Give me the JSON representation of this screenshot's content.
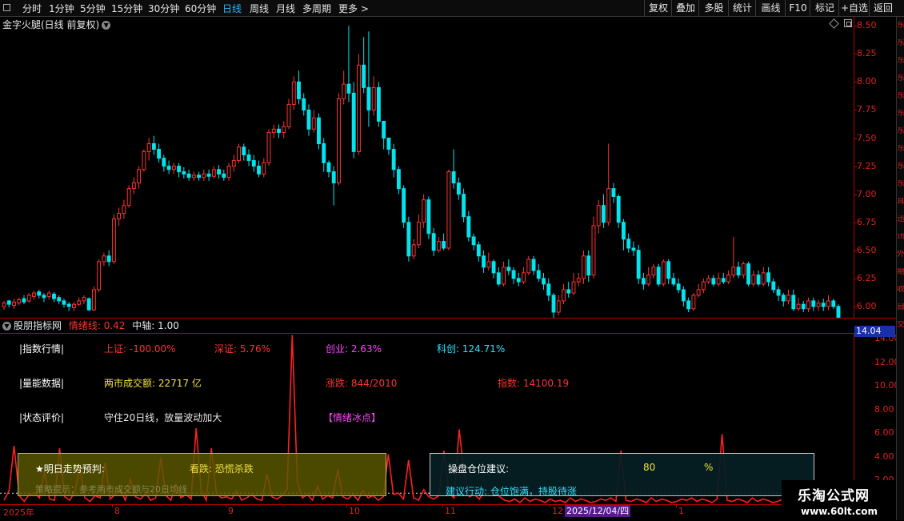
{
  "toolbar": {
    "periods": [
      "分时",
      "1分钟",
      "5分钟",
      "15分钟",
      "30分钟",
      "60分钟",
      "日线",
      "周线",
      "月线",
      "多周期",
      "更多 >"
    ],
    "active_period": "日线",
    "right_buttons": [
      "复权",
      "叠加",
      "多股",
      "统计",
      "画线",
      "F10",
      "标记",
      "+自选",
      "返回"
    ]
  },
  "stock": {
    "title": "金字火腿(日线 前复权)"
  },
  "price_axis": {
    "ticks": [
      "8.50",
      "8.25",
      "8.00",
      "7.75",
      "7.50",
      "7.25",
      "7.00",
      "6.75",
      "6.50",
      "6.25",
      "6.00"
    ]
  },
  "indicator": {
    "name": "股朋指标网",
    "emotion_label": "情绪线:",
    "emotion_value": "0.42",
    "axis_label": "中轴:",
    "axis_value": "1.00",
    "highlight_value": "14.04",
    "ticks": [
      "14.00",
      "12.00",
      "10.00",
      "8.00",
      "6.00",
      "4.00",
      "2.00"
    ]
  },
  "index_row": {
    "label": "|指数行情|",
    "sh": "上证: -100.00%",
    "sz": "深证: 5.76%",
    "cy": "创业: 2.63%",
    "kc": "科创: 124.71%"
  },
  "volume_row": {
    "label": "|量能数据|",
    "turnover": "两市成交额: 22717 亿",
    "updown": "涨跌: 844/2010",
    "index": "指数: 14100.19"
  },
  "status_row": {
    "label": "|状态评价|",
    "text": "守住20日线，放量波动加大",
    "tag": "【情绪冰点】"
  },
  "forecast": {
    "label": "★明日走势预判:",
    "verdict": "看跌: 恐慌杀跌",
    "hint": "策略提示：参考两市成交额与20日均线"
  },
  "position": {
    "label": "操盘仓位建议:",
    "value": "80",
    "unit": "%",
    "action": "建议行动: 仓位饱满，持股待涨"
  },
  "time_axis": {
    "labels": [
      "2025年",
      "8",
      "9",
      "10",
      "11",
      "12",
      "1"
    ],
    "cursor_date": "2025/12/04/四"
  },
  "watermark": {
    "title": "乐淘公式网",
    "url": "www.60lt.com"
  },
  "side_column": [
    "东",
    "东",
    "东",
    "东",
    "东",
    "东",
    "东",
    "东",
    "东",
    "东",
    "耳",
    "迅",
    "讯",
    "外",
    "期",
    "收",
    "自",
    "交"
  ],
  "colors": {
    "up": "#ff3333",
    "down": "#00e5ee",
    "indicator_line": "#ff2020",
    "axis": "#bb0000"
  },
  "chart_data": [
    {
      "type": "candlestick",
      "ylim": [
        5.9,
        8.58
      ],
      "candles": [
        [
          6.0,
          6.03,
          5.97,
          6.05
        ],
        [
          6.05,
          6.02,
          5.99,
          6.06
        ],
        [
          6.01,
          6.04,
          5.98,
          6.07
        ],
        [
          6.03,
          6.06,
          6.01,
          6.08
        ],
        [
          6.07,
          6.04,
          6.02,
          6.1
        ],
        [
          6.05,
          6.1,
          6.03,
          6.12
        ],
        [
          6.09,
          6.12,
          6.06,
          6.14
        ],
        [
          6.13,
          6.1,
          6.07,
          6.15
        ],
        [
          6.1,
          6.08,
          6.04,
          6.12
        ],
        [
          6.09,
          6.12,
          6.06,
          6.14
        ],
        [
          6.11,
          6.07,
          6.04,
          6.13
        ],
        [
          6.08,
          6.05,
          6.02,
          6.1
        ],
        [
          6.05,
          6.02,
          5.99,
          6.07
        ],
        [
          6.02,
          6.0,
          5.96,
          6.04
        ],
        [
          5.99,
          6.02,
          5.96,
          6.04
        ],
        [
          6.02,
          6.05,
          6.0,
          6.08
        ],
        [
          6.05,
          6.08,
          6.02,
          6.1
        ],
        [
          6.07,
          5.97,
          5.96,
          6.08
        ],
        [
          5.97,
          6.15,
          5.96,
          6.18
        ],
        [
          6.15,
          6.4,
          6.13,
          6.42
        ],
        [
          6.4,
          6.45,
          6.36,
          6.48
        ],
        [
          6.45,
          6.4,
          6.36,
          6.5
        ],
        [
          6.4,
          6.78,
          6.38,
          6.82
        ],
        [
          6.78,
          6.83,
          6.72,
          6.88
        ],
        [
          6.83,
          6.9,
          6.78,
          6.95
        ],
        [
          6.9,
          7.05,
          6.88,
          7.08
        ],
        [
          7.05,
          7.1,
          7.0,
          7.15
        ],
        [
          7.1,
          7.22,
          7.05,
          7.25
        ],
        [
          7.22,
          7.38,
          7.2,
          7.4
        ],
        [
          7.38,
          7.45,
          7.3,
          7.5
        ],
        [
          7.45,
          7.4,
          7.35,
          7.52
        ],
        [
          7.4,
          7.32,
          7.28,
          7.45
        ],
        [
          7.32,
          7.25,
          7.2,
          7.35
        ],
        [
          7.25,
          7.22,
          7.18,
          7.3
        ],
        [
          7.22,
          7.25,
          7.18,
          7.28
        ],
        [
          7.25,
          7.2,
          7.15,
          7.28
        ],
        [
          7.2,
          7.18,
          7.14,
          7.24
        ],
        [
          7.18,
          7.15,
          7.12,
          7.22
        ],
        [
          7.15,
          7.17,
          7.12,
          7.2
        ],
        [
          7.17,
          7.15,
          7.12,
          7.2
        ],
        [
          7.15,
          7.18,
          7.12,
          7.22
        ],
        [
          7.18,
          7.16,
          7.12,
          7.22
        ],
        [
          7.16,
          7.22,
          7.14,
          7.25
        ],
        [
          7.22,
          7.18,
          7.14,
          7.26
        ],
        [
          7.18,
          7.15,
          7.12,
          7.22
        ],
        [
          7.15,
          7.25,
          7.12,
          7.28
        ],
        [
          7.25,
          7.3,
          7.2,
          7.35
        ],
        [
          7.3,
          7.42,
          7.28,
          7.45
        ],
        [
          7.42,
          7.35,
          7.3,
          7.45
        ],
        [
          7.35,
          7.3,
          7.25,
          7.4
        ],
        [
          7.3,
          7.25,
          7.2,
          7.35
        ],
        [
          7.25,
          7.18,
          7.15,
          7.3
        ],
        [
          7.18,
          7.28,
          7.15,
          7.32
        ],
        [
          7.28,
          7.55,
          7.25,
          7.58
        ],
        [
          7.55,
          7.58,
          7.5,
          7.62
        ],
        [
          7.58,
          7.55,
          7.5,
          7.62
        ],
        [
          7.55,
          7.6,
          7.5,
          7.65
        ],
        [
          7.6,
          7.8,
          7.58,
          7.85
        ],
        [
          7.8,
          8.0,
          7.75,
          8.05
        ],
        [
          8.0,
          7.85,
          7.8,
          8.1
        ],
        [
          7.85,
          7.75,
          7.7,
          7.9
        ],
        [
          7.75,
          7.58,
          7.52,
          7.8
        ],
        [
          7.58,
          7.68,
          7.55,
          7.75
        ],
        [
          7.68,
          7.45,
          7.4,
          7.72
        ],
        [
          7.45,
          7.28,
          7.2,
          7.5
        ],
        [
          7.28,
          7.2,
          7.15,
          7.3
        ],
        [
          7.2,
          7.1,
          6.9,
          7.25
        ],
        [
          7.1,
          7.85,
          7.08,
          7.9
        ],
        [
          7.85,
          7.98,
          7.8,
          8.1
        ],
        [
          7.98,
          7.9,
          7.82,
          8.5
        ],
        [
          7.9,
          7.38,
          7.32,
          8.0
        ],
        [
          7.38,
          8.15,
          7.35,
          8.25
        ],
        [
          8.15,
          7.95,
          7.9,
          8.4
        ],
        [
          7.95,
          7.75,
          7.6,
          8.45
        ],
        [
          7.75,
          7.95,
          7.7,
          8.05
        ],
        [
          7.95,
          7.65,
          7.6,
          8.0
        ],
        [
          7.65,
          7.5,
          7.4,
          7.65
        ],
        [
          7.5,
          7.4,
          7.35,
          7.5
        ],
        [
          7.4,
          7.22,
          7.15,
          7.45
        ],
        [
          7.22,
          7.05,
          7.0,
          7.25
        ],
        [
          7.05,
          6.75,
          6.7,
          7.08
        ],
        [
          6.75,
          6.45,
          6.4,
          6.8
        ],
        [
          6.45,
          6.55,
          6.42,
          6.6
        ],
        [
          6.55,
          6.75,
          6.52,
          6.82
        ],
        [
          6.75,
          6.95,
          6.7,
          7.0
        ],
        [
          6.95,
          6.65,
          6.6,
          6.98
        ],
        [
          6.65,
          6.5,
          6.45,
          6.7
        ],
        [
          6.5,
          6.58,
          6.48,
          6.62
        ],
        [
          6.58,
          6.52,
          6.5,
          6.65
        ],
        [
          6.52,
          7.2,
          6.5,
          7.22
        ],
        [
          7.2,
          7.1,
          7.05,
          7.4
        ],
        [
          7.1,
          7.0,
          6.95,
          7.15
        ],
        [
          7.0,
          6.8,
          6.75,
          7.05
        ],
        [
          6.8,
          6.62,
          6.58,
          6.85
        ],
        [
          6.62,
          6.55,
          6.5,
          6.65
        ],
        [
          6.55,
          6.45,
          6.4,
          6.58
        ],
        [
          6.45,
          6.35,
          6.3,
          6.5
        ],
        [
          6.35,
          6.4,
          6.32,
          6.48
        ],
        [
          6.4,
          6.3,
          6.25,
          6.42
        ],
        [
          6.3,
          6.2,
          6.18,
          6.35
        ],
        [
          6.2,
          6.35,
          6.18,
          6.4
        ],
        [
          6.35,
          6.32,
          6.28,
          6.42
        ],
        [
          6.32,
          6.25,
          6.2,
          6.35
        ],
        [
          6.25,
          6.22,
          6.18,
          6.3
        ],
        [
          6.22,
          6.3,
          6.2,
          6.35
        ],
        [
          6.3,
          6.42,
          6.28,
          6.45
        ],
        [
          6.42,
          6.32,
          6.28,
          6.45
        ],
        [
          6.32,
          6.25,
          6.22,
          6.38
        ],
        [
          6.25,
          6.2,
          6.15,
          6.3
        ],
        [
          6.2,
          6.1,
          6.05,
          6.25
        ],
        [
          6.1,
          5.95,
          5.9,
          6.12
        ],
        [
          5.95,
          6.05,
          5.92,
          6.1
        ],
        [
          6.05,
          6.15,
          6.02,
          6.2
        ],
        [
          6.15,
          6.12,
          6.08,
          6.22
        ],
        [
          6.12,
          6.22,
          6.1,
          6.3
        ],
        [
          6.22,
          6.25,
          6.18,
          6.3
        ],
        [
          6.25,
          6.45,
          6.2,
          6.5
        ],
        [
          6.45,
          6.28,
          6.22,
          6.5
        ],
        [
          6.28,
          6.72,
          6.25,
          6.8
        ],
        [
          6.72,
          6.9,
          6.65,
          6.95
        ],
        [
          6.9,
          6.75,
          6.7,
          7.0
        ],
        [
          6.75,
          7.05,
          6.72,
          7.45
        ],
        [
          7.05,
          6.98,
          6.92,
          7.1
        ],
        [
          6.98,
          6.75,
          6.7,
          7.0
        ],
        [
          6.75,
          6.6,
          6.5,
          6.78
        ],
        [
          6.6,
          6.52,
          6.48,
          6.65
        ],
        [
          6.52,
          6.5,
          6.45,
          6.58
        ],
        [
          6.5,
          6.25,
          6.2,
          6.55
        ],
        [
          6.25,
          6.2,
          6.15,
          6.3
        ],
        [
          6.2,
          6.28,
          6.18,
          6.35
        ],
        [
          6.28,
          6.35,
          6.25,
          6.38
        ],
        [
          6.35,
          6.2,
          6.18,
          6.38
        ],
        [
          6.2,
          6.4,
          6.18,
          6.42
        ],
        [
          6.4,
          6.25,
          6.2,
          6.42
        ],
        [
          6.25,
          6.2,
          6.18,
          6.3
        ],
        [
          6.2,
          6.15,
          6.12,
          6.25
        ],
        [
          6.15,
          6.05,
          6.0,
          6.18
        ],
        [
          6.05,
          5.98,
          5.95,
          6.08
        ],
        [
          5.98,
          6.1,
          5.96,
          6.12
        ],
        [
          6.1,
          6.15,
          6.08,
          6.2
        ],
        [
          6.15,
          6.22,
          6.12,
          6.25
        ],
        [
          6.22,
          6.25,
          6.2,
          6.28
        ],
        [
          6.25,
          6.2,
          6.18,
          6.28
        ],
        [
          6.2,
          6.25,
          6.18,
          6.3
        ],
        [
          6.25,
          6.22,
          6.2,
          6.3
        ],
        [
          6.22,
          6.28,
          6.2,
          6.32
        ],
        [
          6.28,
          6.35,
          6.25,
          6.62
        ],
        [
          6.35,
          6.28,
          6.25,
          6.4
        ],
        [
          6.28,
          6.38,
          6.25,
          6.4
        ],
        [
          6.38,
          6.2,
          6.18,
          6.4
        ],
        [
          6.2,
          6.28,
          6.18,
          6.32
        ],
        [
          6.28,
          6.2,
          6.18,
          6.32
        ],
        [
          6.2,
          6.3,
          6.18,
          6.35
        ],
        [
          6.3,
          6.22,
          6.18,
          6.35
        ],
        [
          6.22,
          6.15,
          6.12,
          6.25
        ],
        [
          6.15,
          6.1,
          6.05,
          6.18
        ],
        [
          6.1,
          6.05,
          6.0,
          6.12
        ],
        [
          6.05,
          6.1,
          6.02,
          6.15
        ],
        [
          6.1,
          5.98,
          5.96,
          6.15
        ],
        [
          5.98,
          6.02,
          5.96,
          6.08
        ],
        [
          6.02,
          5.98,
          5.95,
          6.05
        ],
        [
          5.98,
          6.05,
          5.95,
          6.08
        ],
        [
          6.05,
          6.0,
          5.96,
          6.08
        ],
        [
          6.0,
          6.03,
          5.96,
          6.06
        ],
        [
          6.03,
          6.0,
          5.96,
          6.07
        ],
        [
          6.0,
          6.05,
          5.97,
          6.1
        ],
        [
          6.05,
          6.0,
          5.98,
          6.07
        ],
        [
          6.0,
          5.9,
          5.88,
          6.02
        ]
      ]
    },
    {
      "type": "line",
      "name": "情绪线",
      "ylim": [
        0,
        14.5
      ],
      "values": [
        0.4,
        1.2,
        5.0,
        0.8,
        0.3,
        0.9,
        1.0,
        0.6,
        2.8,
        0.5,
        0.4,
        4.8,
        0.7,
        0.4,
        1.1,
        3.2,
        0.6,
        0.3,
        0.8,
        0.6,
        3.6,
        0.5,
        0.9,
        1.3,
        0.4,
        2.2,
        0.7,
        0.5,
        1.0,
        0.4,
        0.6,
        4.0,
        0.8,
        0.4,
        1.8,
        0.6,
        0.9,
        0.5,
        6.5,
        1.2,
        0.4,
        4.8,
        1.0,
        0.6,
        0.7,
        0.5,
        1.2,
        0.4,
        0.6,
        0.9,
        0.5,
        0.4,
        2.6,
        0.7,
        0.5,
        0.8,
        1.4,
        14.4,
        2.0,
        0.6,
        0.9,
        0.4,
        1.6,
        0.5,
        0.8,
        0.6,
        3.0,
        0.7,
        0.5,
        0.9,
        0.4,
        1.2,
        0.6,
        0.8,
        0.4,
        0.7,
        4.3,
        0.9,
        1.0,
        0.5,
        3.8,
        0.6,
        0.4,
        1.3,
        0.7,
        0.5,
        0.8,
        4.6,
        1.0,
        0.6,
        6.4,
        2.8,
        0.7,
        0.9,
        0.5,
        1.2,
        0.8,
        1.6,
        0.7,
        0.4,
        0.3,
        0.5,
        0.2,
        0.6,
        0.3,
        0.5,
        0.4,
        0.2,
        0.5,
        0.3,
        0.4,
        0.2,
        0.6,
        0.3,
        0.5,
        0.4,
        0.2,
        0.3,
        0.5,
        0.4,
        0.6,
        0.3,
        4.6,
        0.4,
        0.3,
        0.5,
        0.4,
        0.2,
        0.6,
        0.3,
        0.5,
        0.4,
        0.2,
        0.3,
        0.5,
        0.4,
        0.6,
        0.3,
        0.5,
        0.4,
        0.2,
        0.5,
        6.0,
        0.4,
        0.3,
        0.5,
        0.4,
        0.2,
        0.6,
        0.3,
        0.5,
        0.4,
        0.2,
        0.3,
        0.5,
        0.4,
        0.6,
        0.3,
        0.5,
        0.4,
        0.2,
        0.5,
        0.3,
        0.4,
        0.6,
        0.3
      ]
    }
  ]
}
